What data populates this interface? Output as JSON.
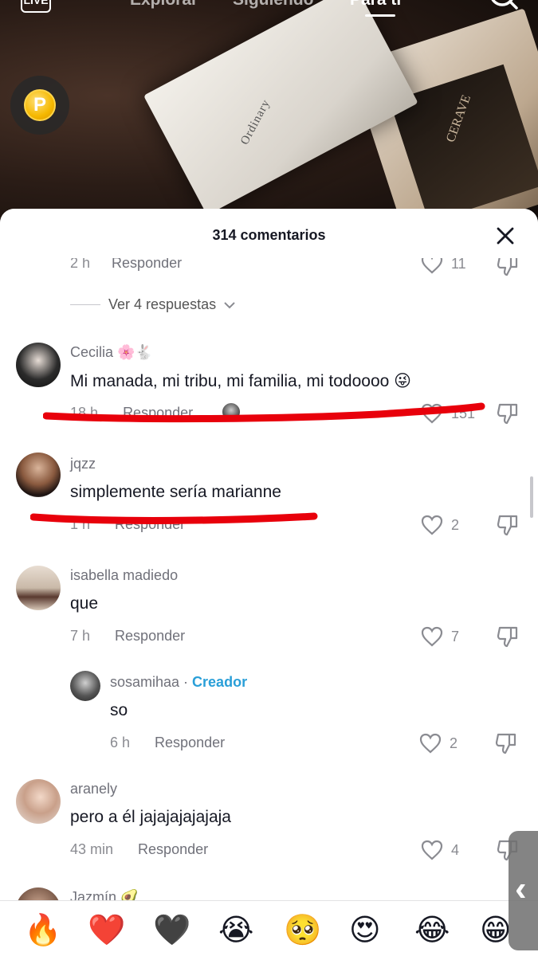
{
  "topnav": {
    "live_label": "LIVE",
    "tabs": [
      {
        "label": "Explorar"
      },
      {
        "label": "Siguiendo"
      },
      {
        "label": "Para ti"
      }
    ]
  },
  "video": {
    "box1_text": "Ordinary",
    "box2_text": "CERAVE"
  },
  "coin_label": "P",
  "sheet": {
    "title": "314 comentarios"
  },
  "comments": {
    "partial_top": {
      "time": "2 h",
      "reply_label": "Responder",
      "likes": "11"
    },
    "view_replies": "Ver 4 respuestas",
    "items": [
      {
        "username": "Cecilia 🌸🐇",
        "text": "Mi manada, mi tribu, mi familia, mi todoooo 😜",
        "time": "18 h",
        "reply_label": "Responder",
        "likes": "151"
      },
      {
        "username": "jqzz",
        "text": "simplemente sería marianne",
        "time": "1 h",
        "reply_label": "Responder",
        "likes": "2"
      },
      {
        "username": "isabella madiedo",
        "text": "que",
        "time": "7 h",
        "reply_label": "Responder",
        "likes": "7"
      },
      {
        "username": "aranely",
        "text": "pero a él jajajajajajaja",
        "time": "43 min",
        "reply_label": "Responder",
        "likes": "4"
      },
      {
        "username": "Jazmín 🥑"
      }
    ],
    "reply": {
      "username": "sosamihaa",
      "separator": " · ",
      "creator_label": "Creador",
      "text": "so",
      "time": "6 h",
      "reply_label": "Responder",
      "likes": "2"
    }
  },
  "emoji_bar": [
    "🔥",
    "❤️",
    "🖤",
    "😭",
    "🥺",
    "😍",
    "😂",
    "😁"
  ],
  "side_handle": "‹",
  "colors": {
    "creator": "#2a9fd8",
    "highlight_stroke": "#e8000b"
  }
}
